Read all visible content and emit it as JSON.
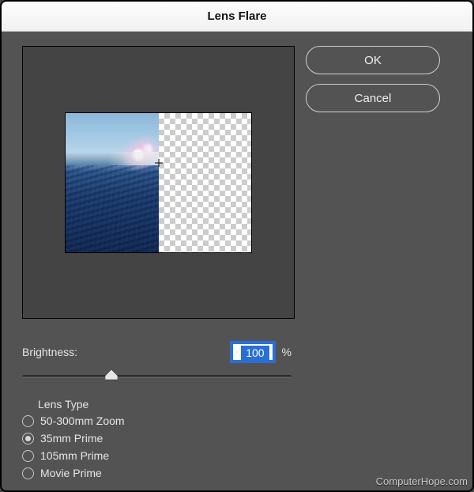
{
  "dialog": {
    "title": "Lens Flare"
  },
  "buttons": {
    "ok": "OK",
    "cancel": "Cancel"
  },
  "brightness": {
    "label": "Brightness:",
    "value": "100",
    "unit": "%",
    "slider_position_percent": 33
  },
  "lens_type": {
    "heading": "Lens Type",
    "selected_index": 1,
    "options": [
      "50-300mm Zoom",
      "35mm Prime",
      "105mm Prime",
      "Movie Prime"
    ]
  },
  "watermark": "ComputerHope.com"
}
